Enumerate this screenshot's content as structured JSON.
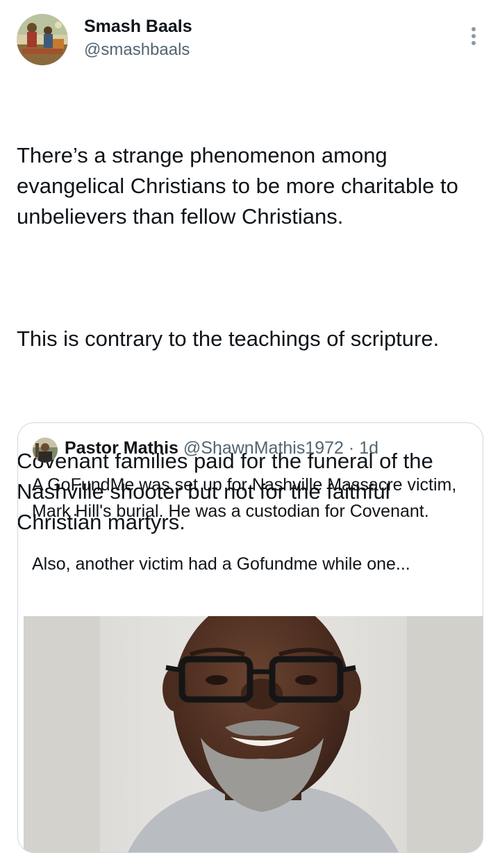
{
  "author": {
    "display_name": "Smash Baals",
    "handle": "@smashbaals",
    "avatar_icon": "painting-avatar-icon"
  },
  "tweet": {
    "paragraphs": [
      "There’s a strange phenomenon among evangelical Christians to be more charitable to unbelievers than fellow Christians.",
      "This is contrary to the teachings of scripture.",
      "Covenant families paid for the funeral of the Nashville shooter but not for the faithful Christian martyrs."
    ]
  },
  "more_icon": "more-vertical-icon",
  "quote": {
    "author_name": "Pastor Mathis",
    "author_handle": "@ShawnMathis1972",
    "separator": "·",
    "time": "1d",
    "paragraphs": [
      "A GoFundMe was set up for Nashville Massacre victim, Mark Hill's burial. He was a custodian for Covenant.",
      "Also, another victim had a Gofundme while one..."
    ],
    "media_icon": "man-portrait-photo"
  },
  "colors": {
    "text": "#0f1419",
    "secondary": "#536471",
    "border": "#cfd9de"
  }
}
